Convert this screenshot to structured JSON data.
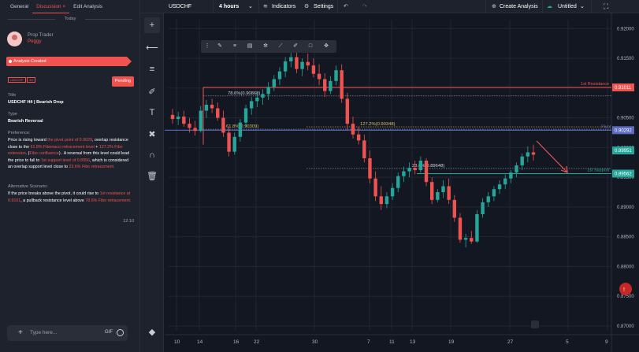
{
  "left_panel": {
    "tabs": [
      "General",
      "Discussion",
      "Edit Analysis"
    ],
    "discussion_close": "×",
    "today": "Today",
    "user": {
      "role": "Prop Trader",
      "name": "Peggy"
    },
    "status_banner": "Analysis Created",
    "tags": [
      "USDCHF",
      "4H"
    ],
    "pending": "Pending",
    "title_label": "Title",
    "title_value": "USDCHF H4 | Bearish Drop",
    "type_label": "Type",
    "type_value": "Bearish Reversal",
    "preference_label": "Preference:",
    "preference_parts": [
      [
        "Price is rising toward ",
        false
      ],
      [
        "the pivot point of 0.9029",
        true
      ],
      [
        ", overlap resistance close to the ",
        false
      ],
      [
        "61.8% Fibonacci retracement level",
        true
      ],
      [
        " + ",
        false
      ],
      [
        "127.2% Fibo extension",
        true
      ],
      [
        ". (",
        false
      ],
      [
        "Fibo confluence",
        true
      ],
      [
        ") . A reversal from this level could lead the price to fall to ",
        false
      ],
      [
        "1st support level of 0.8956",
        true
      ],
      [
        ", which is considered an overlap support level close to ",
        false
      ],
      [
        "23.6% Fibo retracement.",
        true
      ]
    ],
    "alt_label": "Alternative Scenario:",
    "alt_parts": [
      [
        "If the price breaks above the pivot, it could rise to ",
        false
      ],
      [
        "1st resistance at 0.9101",
        true
      ],
      [
        ", a pullback resistance level above ",
        false
      ],
      [
        "78.6% Fibo retracement.",
        true
      ]
    ],
    "time": "12:10",
    "input_placeholder": "Type here...",
    "gif": "GIF",
    "plus": "+"
  },
  "top_bar": {
    "symbol": "USDCHF",
    "interval": "4 hours",
    "indicators": "Indicators",
    "settings": "Settings",
    "create_analysis": "Create Analysis",
    "layout_name": "Untitled",
    "undo": "↶",
    "redo": "↷"
  },
  "chart_data": {
    "type": "candlestick",
    "price_axis": [
      "0.92000",
      "0.91500",
      "0.91000",
      "0.90500",
      "0.90000",
      "0.89500",
      "0.89000",
      "0.88500",
      "0.88000",
      "0.87500",
      "0.87000"
    ],
    "time_axis": [
      "10",
      "14",
      "16",
      "22",
      "30",
      "7",
      "11",
      "13",
      "19",
      "27",
      "5",
      "9"
    ],
    "markers": [
      {
        "label": "1st Resistance",
        "price": "0.91011",
        "color": "#ef5350"
      },
      {
        "label": "Pivot",
        "price": "0.90292",
        "color": "#5c6bc0"
      },
      {
        "label": "1st Support",
        "price": "0.89562",
        "color": "#26a69a"
      },
      {
        "label": "",
        "price": "0.89951",
        "color": "#26a69a"
      },
      {
        "label": "",
        "price": "0.87500",
        "color": "#c62828"
      }
    ],
    "fib_labels": [
      "78.6%(0.90868)",
      "61.8%(0.90309)",
      "127.2%(0.90348)",
      "23.6%(0.89648)"
    ],
    "candles": [
      [
        0.9055,
        0.9065,
        0.904,
        0.9048
      ],
      [
        0.9048,
        0.906,
        0.9038,
        0.9052
      ],
      [
        0.9052,
        0.9062,
        0.9035,
        0.904
      ],
      [
        0.904,
        0.905,
        0.9025,
        0.9033
      ],
      [
        0.9033,
        0.9045,
        0.902,
        0.9028
      ],
      [
        0.9028,
        0.907,
        0.9025,
        0.9062
      ],
      [
        0.9062,
        0.908,
        0.905,
        0.9072
      ],
      [
        0.9072,
        0.9082,
        0.9058,
        0.9066
      ],
      [
        0.9066,
        0.9076,
        0.9045,
        0.905
      ],
      [
        0.905,
        0.9062,
        0.9018,
        0.9025
      ],
      [
        0.9025,
        0.9035,
        0.8985,
        0.8993
      ],
      [
        0.8993,
        0.9025,
        0.8988,
        0.9018
      ],
      [
        0.9018,
        0.9048,
        0.901,
        0.9042
      ],
      [
        0.9042,
        0.9072,
        0.9035,
        0.9066
      ],
      [
        0.9066,
        0.9085,
        0.9055,
        0.9078
      ],
      [
        0.9078,
        0.9092,
        0.9068,
        0.9084
      ],
      [
        0.9084,
        0.9098,
        0.9072,
        0.909
      ],
      [
        0.909,
        0.911,
        0.908,
        0.9102
      ],
      [
        0.9102,
        0.9122,
        0.9095,
        0.9115
      ],
      [
        0.9115,
        0.9135,
        0.9105,
        0.9128
      ],
      [
        0.9128,
        0.9152,
        0.9118,
        0.9145
      ],
      [
        0.9145,
        0.9162,
        0.9135,
        0.9152
      ],
      [
        0.9152,
        0.916,
        0.9125,
        0.9132
      ],
      [
        0.9132,
        0.915,
        0.912,
        0.9144
      ],
      [
        0.9144,
        0.9158,
        0.913,
        0.9138
      ],
      [
        0.9138,
        0.915,
        0.9118,
        0.9124
      ],
      [
        0.9124,
        0.914,
        0.9105,
        0.9115
      ],
      [
        0.9115,
        0.9125,
        0.9085,
        0.9095
      ],
      [
        0.9095,
        0.912,
        0.909,
        0.9112
      ],
      [
        0.9112,
        0.9138,
        0.9105,
        0.913
      ],
      [
        0.913,
        0.914,
        0.9075,
        0.9082
      ],
      [
        0.9082,
        0.9092,
        0.903,
        0.904
      ],
      [
        0.904,
        0.9052,
        0.9015,
        0.9022
      ],
      [
        0.9022,
        0.9035,
        0.9005,
        0.9012
      ],
      [
        0.9012,
        0.9022,
        0.8975,
        0.8982
      ],
      [
        0.8982,
        0.8995,
        0.894,
        0.8948
      ],
      [
        0.8948,
        0.896,
        0.891,
        0.8918
      ],
      [
        0.8918,
        0.8935,
        0.8895,
        0.8905
      ],
      [
        0.8905,
        0.8925,
        0.8898,
        0.8918
      ],
      [
        0.8918,
        0.894,
        0.8912,
        0.8932
      ],
      [
        0.8932,
        0.8958,
        0.8925,
        0.8952
      ],
      [
        0.8952,
        0.8968,
        0.8942,
        0.896
      ],
      [
        0.896,
        0.8975,
        0.895,
        0.8966
      ],
      [
        0.8966,
        0.8978,
        0.8955,
        0.8962
      ],
      [
        0.8962,
        0.8985,
        0.8958,
        0.8978
      ],
      [
        0.8978,
        0.8982,
        0.8935,
        0.8942
      ],
      [
        0.8942,
        0.895,
        0.8905,
        0.8912
      ],
      [
        0.8912,
        0.893,
        0.8908,
        0.8925
      ],
      [
        0.8925,
        0.8945,
        0.8915,
        0.8935
      ],
      [
        0.8935,
        0.8948,
        0.8905,
        0.8912
      ],
      [
        0.8912,
        0.892,
        0.8875,
        0.8882
      ],
      [
        0.8882,
        0.889,
        0.884,
        0.8845
      ],
      [
        0.8845,
        0.8855,
        0.8832,
        0.8848
      ],
      [
        0.8848,
        0.886,
        0.8838,
        0.8842
      ],
      [
        0.8842,
        0.8895,
        0.884,
        0.8888
      ],
      [
        0.8888,
        0.8915,
        0.8882,
        0.8908
      ],
      [
        0.8908,
        0.8925,
        0.89,
        0.8918
      ],
      [
        0.8918,
        0.8935,
        0.891,
        0.893
      ],
      [
        0.893,
        0.8945,
        0.8922,
        0.8938
      ],
      [
        0.8938,
        0.8955,
        0.893,
        0.8948
      ],
      [
        0.8948,
        0.8962,
        0.894,
        0.8958
      ],
      [
        0.8958,
        0.8975,
        0.895,
        0.897
      ],
      [
        0.897,
        0.899,
        0.8962,
        0.8985
      ],
      [
        0.8985,
        0.9002,
        0.8975,
        0.8992
      ],
      [
        0.8992,
        0.9005,
        0.8978,
        0.8988
      ]
    ]
  },
  "drawing_tools": [
    "cursor-icon",
    "line-icon",
    "fib-icon",
    "brush-icon",
    "text-icon",
    "pattern-icon",
    "magnet-icon",
    "trash-icon",
    "layers-icon"
  ]
}
